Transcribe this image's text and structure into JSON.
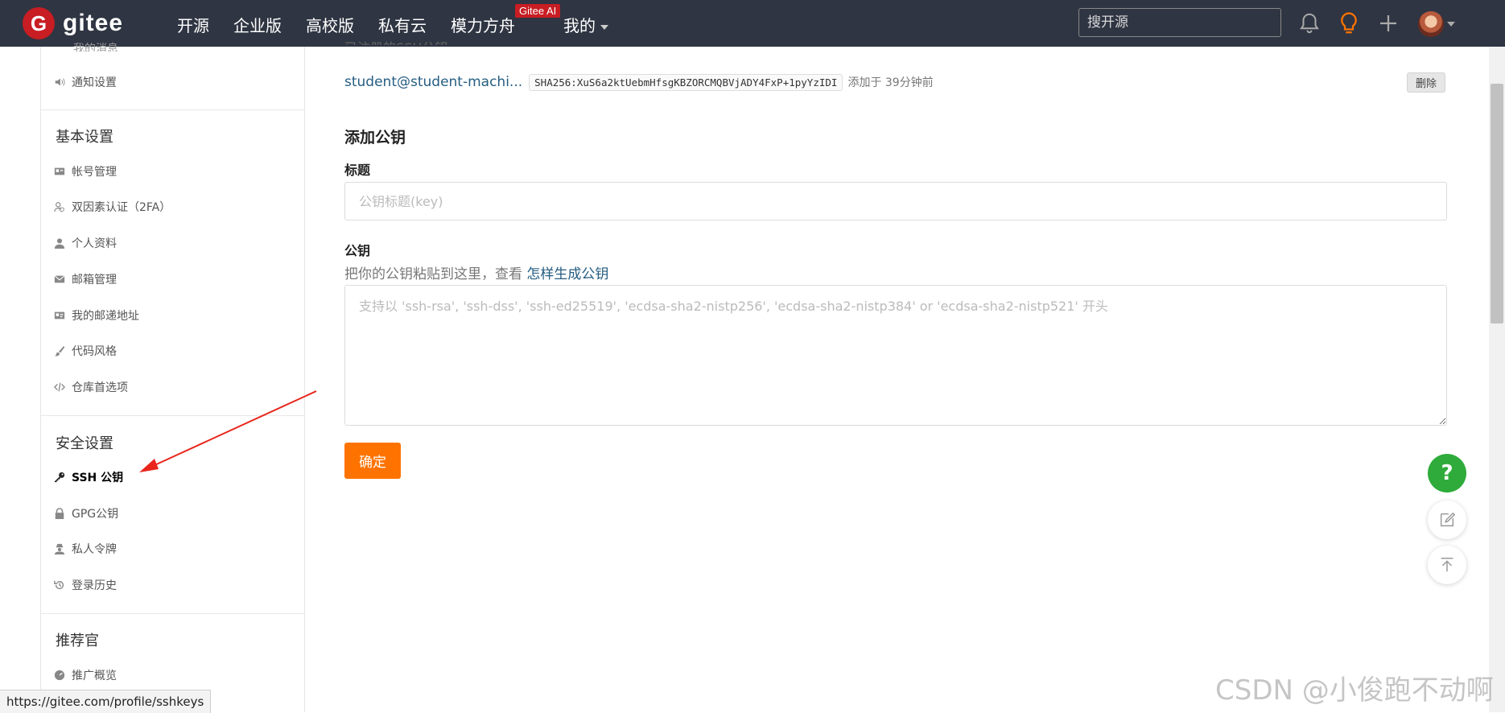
{
  "nav": {
    "logo_text": "gitee",
    "items": [
      "开源",
      "企业版",
      "高校版",
      "私有云",
      "模力方舟",
      "我的"
    ],
    "ai_badge": "Gitee AI",
    "search_placeholder": "搜开源",
    "icons": [
      "bell-icon",
      "lightbulb-icon",
      "plus-icon"
    ]
  },
  "sidebar": {
    "partial_top": "我的消息",
    "notify": "通知设置",
    "basic_header": "基本设置",
    "basic_items": [
      "帐号管理",
      "双因素认证（2FA）",
      "个人资料",
      "邮箱管理",
      "我的邮递地址",
      "代码风格",
      "仓库首选项"
    ],
    "security_header": "安全设置",
    "security_items": [
      "SSH 公钥",
      "GPG公钥",
      "私人令牌",
      "登录历史"
    ],
    "active_item": "SSH 公钥",
    "referrer_header": "推荐官",
    "referrer_items": [
      "推广概览"
    ]
  },
  "main": {
    "partial_top": "已注册的SSH公钥",
    "existing_key": {
      "title": "student@student-machi...",
      "fingerprint": "SHA256:XuS6a2ktUebmHfsgKBZORCMQBVjADY4FxP+1pyYzIDI",
      "added": "添加于 39分钟前",
      "delete_label": "删除"
    },
    "section_title": "添加公钥",
    "title_label": "标题",
    "title_placeholder": "公钥标题(key)",
    "key_label": "公钥",
    "hint_text": "把你的公钥粘贴到这里，查看 ",
    "hint_link": "怎样生成公钥",
    "key_placeholder": "支持以 'ssh-rsa', 'ssh-dss', 'ssh-ed25519', 'ecdsa-sha2-nistp256', 'ecdsa-sha2-nistp384' or 'ecdsa-sha2-nistp521' 开头",
    "confirm_label": "确定"
  },
  "floating": {
    "help_label": "?"
  },
  "status_url": "https://gitee.com/profile/sshkeys",
  "watermark": "CSDN @小俊跑不动啊",
  "colors": {
    "nav_bg": "#2f3542",
    "brand_red": "#c71d23",
    "confirm_orange": "#fe7300",
    "link_blue": "#255d82",
    "help_green": "#2eab3a"
  }
}
